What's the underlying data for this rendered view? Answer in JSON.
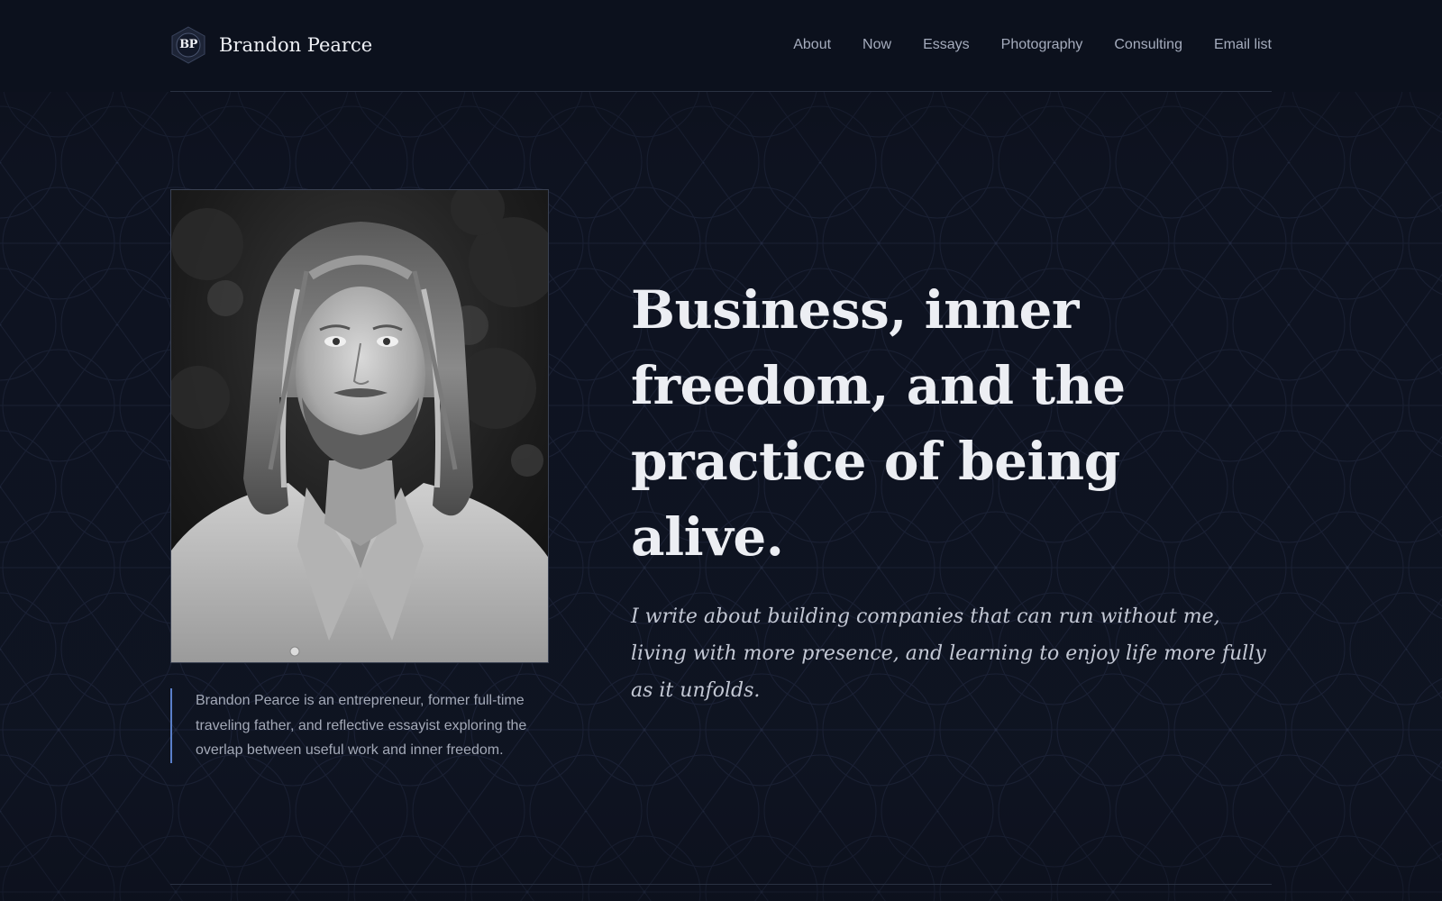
{
  "brand": {
    "initials": "BP",
    "name": "Brandon Pearce"
  },
  "nav": {
    "items": [
      {
        "label": "About"
      },
      {
        "label": "Now"
      },
      {
        "label": "Essays"
      },
      {
        "label": "Photography"
      },
      {
        "label": "Consulting"
      },
      {
        "label": "Email list"
      }
    ]
  },
  "hero": {
    "title": "Business, inner freedom, and the practice of being alive.",
    "subtitle": "I write about building companies that can run without me, living with more presence, and learning to enjoy life more fully as it unfolds."
  },
  "bio": {
    "text": "Brandon Pearce is an entrepreneur, former full-time traveling father, and reflective essayist exploring the overlap between useful work and inner freedom."
  },
  "colors": {
    "background": "#0f1422",
    "header": "#0c111d",
    "accent": "#5a7fc9",
    "text": "#eceef3",
    "muted": "#a3a9b7"
  },
  "icons": {
    "brand_mark": "hexagon-monogram-icon"
  },
  "portrait": {
    "description_icon": "black-and-white-portrait"
  }
}
